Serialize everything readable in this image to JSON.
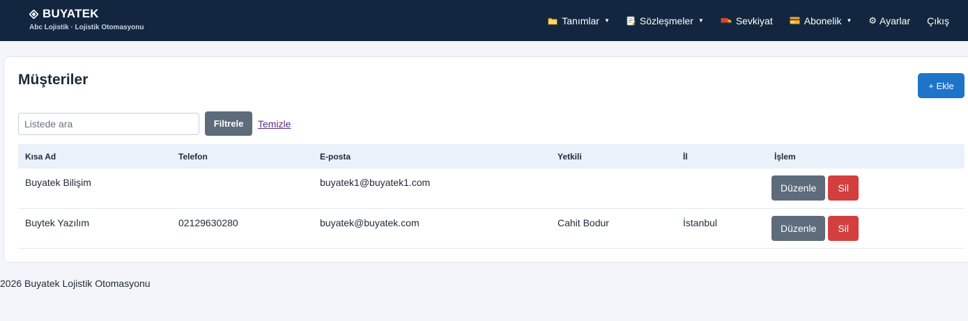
{
  "brand": {
    "title": "BUYATEK",
    "subtitle": "Abc Lojistik · Lojistik Otomasyonu",
    "icon": "diamond-icon"
  },
  "nav": {
    "items": [
      {
        "label": "Tanımlar",
        "icon": "folder-icon",
        "dropdown": true
      },
      {
        "label": "Sözleşmeler",
        "icon": "memo-icon",
        "dropdown": true
      },
      {
        "label": "Sevkiyat",
        "icon": "truck-icon",
        "dropdown": false
      },
      {
        "label": "Abonelik",
        "icon": "credit-card-icon",
        "dropdown": true
      },
      {
        "label": "Ayarlar",
        "icon": "gear-icon",
        "dropdown": false
      },
      {
        "label": "Çıkış",
        "icon": "",
        "dropdown": false
      }
    ],
    "caret": "▼",
    "gear_glyph": "⚙"
  },
  "page": {
    "title": "Müşteriler",
    "add_label": "+ Ekle"
  },
  "filter": {
    "search_placeholder": "Listede ara",
    "search_value": "",
    "filter_label": "Filtrele",
    "clear_label": "Temizle"
  },
  "table": {
    "columns": [
      "Kısa Ad",
      "Telefon",
      "E-posta",
      "Yetkili",
      "İl",
      "İşlem"
    ],
    "rows": [
      {
        "short_name": "Buyatek Bilişim",
        "phone": "",
        "email": "buyatek1@buyatek1.com",
        "contact": "",
        "city": "",
        "edit": "Düzenle",
        "delete": "Sil"
      },
      {
        "short_name": "Buytek Yazılım",
        "phone": "02129630280",
        "email": "buyatek@buyatek.com",
        "contact": "Cahit Bodur",
        "city": "İstanbul",
        "edit": "Düzenle",
        "delete": "Sil"
      }
    ]
  },
  "footer": {
    "text": "2026 Buyatek Lojistik Otomasyonu"
  },
  "colors": {
    "navbar": "#12273f",
    "primary": "#1d74c9",
    "secondary": "#5d6b7b",
    "danger": "#d33f3f",
    "table_header": "#eaf1fa"
  }
}
